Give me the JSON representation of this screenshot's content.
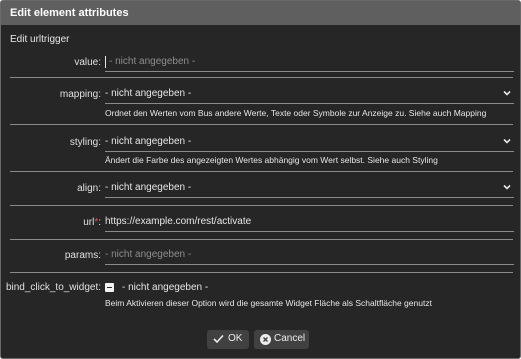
{
  "dialog": {
    "title": "Edit element attributes",
    "subtitle": "Edit urltrigger"
  },
  "fields": {
    "value": {
      "label": "value:",
      "placeholder": "- nicht angegeben -"
    },
    "mapping": {
      "label": "mapping:",
      "selected": "- nicht angegeben -",
      "help": "Ordnet den Werten vom Bus andere Werte, Texte oder Symbole zur Anzeige zu. Siehe auch Mapping"
    },
    "styling": {
      "label": "styling:",
      "selected": "- nicht angegeben -",
      "help": "Ändert die Farbe des angezeigten Wertes abhängig vom Wert selbst. Siehe auch Styling"
    },
    "align": {
      "label": "align:",
      "selected": "- nicht angegeben -"
    },
    "url": {
      "label": "url",
      "required_mark": "*",
      "label_colon": ":",
      "value": "https://example.com/rest/activate"
    },
    "params": {
      "label": "params:",
      "placeholder": "- nicht angegeben -"
    },
    "bind_click_to_widget": {
      "label": "bind_click_to_widget:",
      "checkbox_text": "- nicht angegeben -",
      "help": "Beim Aktivieren dieser Option wird die gesamte Widget Fläche als Schaltfläche genutzt"
    }
  },
  "buttons": {
    "ok_label": "OK",
    "cancel_label": "Cancel"
  },
  "icons": {
    "dropdown": "chevron-down-icon",
    "ok": "check-icon",
    "cancel": "close-circle-icon"
  },
  "colors": {
    "titlebar": "#5f5f5f",
    "background": "#262626",
    "required": "#e05050"
  }
}
